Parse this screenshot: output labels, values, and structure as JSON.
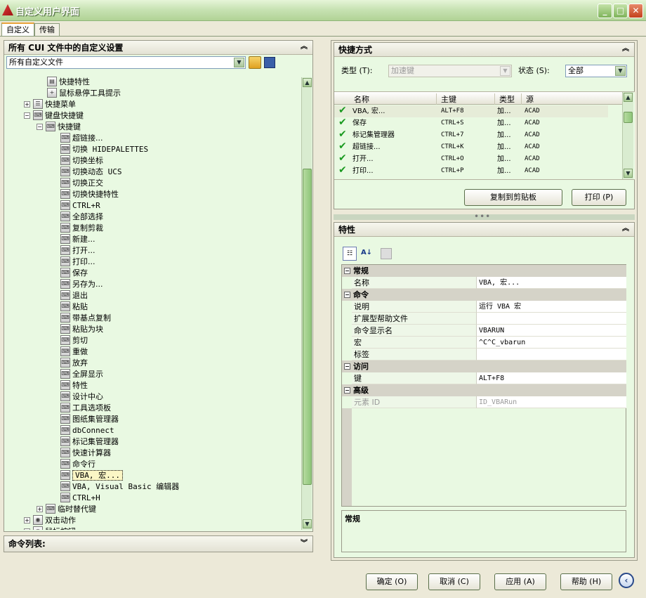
{
  "window": {
    "title": "自定义用户界面"
  },
  "tabs": [
    "自定义",
    "传输"
  ],
  "left": {
    "header": "所有 CUI 文件中的自定义设置",
    "file_combo": "所有自定义文件",
    "tree": [
      {
        "label": "快捷特性",
        "depth": 2
      },
      {
        "label": "鼠标悬停工具提示",
        "depth": 2
      },
      {
        "label": "快捷菜单",
        "depth": 1
      },
      {
        "label": "键盘快捷键",
        "depth": 1
      },
      {
        "label": "快捷键",
        "depth": 2
      },
      {
        "label": "超链接...",
        "depth": 3
      },
      {
        "label": "切换 HIDEPALETTES",
        "depth": 3
      },
      {
        "label": "切换坐标",
        "depth": 3
      },
      {
        "label": "切换动态 UCS",
        "depth": 3
      },
      {
        "label": "切换正交",
        "depth": 3
      },
      {
        "label": "切换快捷特性",
        "depth": 3
      },
      {
        "label": "CTRL+R",
        "depth": 3
      },
      {
        "label": "全部选择",
        "depth": 3
      },
      {
        "label": "复制剪裁",
        "depth": 3
      },
      {
        "label": "新建...",
        "depth": 3
      },
      {
        "label": "打开...",
        "depth": 3
      },
      {
        "label": "打印...",
        "depth": 3
      },
      {
        "label": "保存",
        "depth": 3
      },
      {
        "label": "另存为...",
        "depth": 3
      },
      {
        "label": "退出",
        "depth": 3
      },
      {
        "label": "粘贴",
        "depth": 3
      },
      {
        "label": "带基点复制",
        "depth": 3
      },
      {
        "label": "粘贴为块",
        "depth": 3
      },
      {
        "label": "剪切",
        "depth": 3
      },
      {
        "label": "重做",
        "depth": 3
      },
      {
        "label": "放弃",
        "depth": 3
      },
      {
        "label": "全屏显示",
        "depth": 3
      },
      {
        "label": "特性",
        "depth": 3
      },
      {
        "label": "设计中心",
        "depth": 3
      },
      {
        "label": "工具选项板",
        "depth": 3
      },
      {
        "label": "图纸集管理器",
        "depth": 3
      },
      {
        "label": "dbConnect",
        "depth": 3
      },
      {
        "label": "标记集管理器",
        "depth": 3
      },
      {
        "label": "快速计算器",
        "depth": 3
      },
      {
        "label": "命令行",
        "depth": 3
      },
      {
        "label": "VBA, 宏...",
        "depth": 3
      },
      {
        "label": "VBA, Visual Basic 编辑器",
        "depth": 3
      },
      {
        "label": "CTRL+H",
        "depth": 3
      },
      {
        "label": "临时替代键",
        "depth": 2
      },
      {
        "label": "双击动作",
        "depth": 1
      },
      {
        "label": "鼠标按钮",
        "depth": 1
      }
    ],
    "command_list": "命令列表:"
  },
  "shortcuts": {
    "header": "快捷方式",
    "type_label": "类型 (T):",
    "type_value": "加速键",
    "status_label": "状态 (S):",
    "status_value": "全部",
    "columns": [
      "名称",
      "主键",
      "类型",
      "源"
    ],
    "rows": [
      [
        "VBA, 宏...",
        "ALT+F8",
        "加...",
        "ACAD"
      ],
      [
        "保存",
        "CTRL+S",
        "加...",
        "ACAD"
      ],
      [
        "标记集管理器",
        "CTRL+7",
        "加...",
        "ACAD"
      ],
      [
        "超链接...",
        "CTRL+K",
        "加...",
        "ACAD"
      ],
      [
        "打开...",
        "CTRL+O",
        "加...",
        "ACAD"
      ],
      [
        "打印...",
        "CTRL+P",
        "加...",
        "ACAD"
      ]
    ],
    "copy_button": "复制到剪贴板",
    "print_button": "打印 (P)"
  },
  "properties": {
    "header": "特性",
    "sections": [
      {
        "name": "常规",
        "rows": [
          [
            "名称",
            "VBA, 宏..."
          ]
        ]
      },
      {
        "name": "命令",
        "rows": [
          [
            "说明",
            "运行 VBA 宏"
          ],
          [
            "扩展型帮助文件",
            ""
          ],
          [
            "命令显示名",
            "VBARUN"
          ],
          [
            "宏",
            "^C^C_vbarun"
          ],
          [
            "标签",
            ""
          ]
        ]
      },
      {
        "name": "访问",
        "rows": [
          [
            "键",
            "ALT+F8"
          ]
        ]
      },
      {
        "name": "高级",
        "rows": [
          [
            "元素 ID",
            "ID_VBARun"
          ]
        ]
      }
    ],
    "description_title": "常规"
  },
  "footer": {
    "ok": "确定 (O)",
    "cancel": "取消 (C)",
    "apply": "应用 (A)",
    "help": "帮助 (H)"
  }
}
